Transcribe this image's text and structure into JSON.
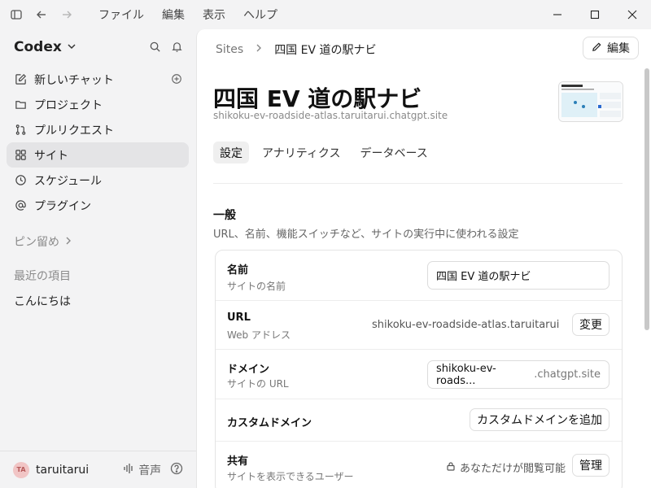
{
  "menubar": {
    "items": [
      "ファイル",
      "編集",
      "表示",
      "ヘルプ"
    ]
  },
  "sidebar": {
    "workspace": "Codex",
    "nav": [
      {
        "label": "新しいチャット",
        "icon": "edit-icon"
      },
      {
        "label": "プロジェクト",
        "icon": "folder-icon"
      },
      {
        "label": "プルリクエスト",
        "icon": "pull-request-icon"
      },
      {
        "label": "サイト",
        "icon": "grid-icon"
      },
      {
        "label": "スケジュール",
        "icon": "clock-icon"
      },
      {
        "label": "プラグイン",
        "icon": "at-icon"
      }
    ],
    "pinned_label": "ピン留め",
    "recent_label": "最近の項目",
    "recent_chats": [
      "こんにちは"
    ],
    "user": {
      "initials": "TA",
      "name": "taruitarui"
    },
    "voice_label": "音声"
  },
  "main": {
    "breadcrumb": {
      "root": "Sites",
      "current": "四国 EV 道の駅ナビ"
    },
    "edit_label": "編集",
    "title": "四国 EV 道の駅ナビ",
    "url": "shikoku-ev-roadside-atlas.taruitarui.chatgpt.site",
    "tabs": [
      "設定",
      "アナリティクス",
      "データベース"
    ],
    "active_tab": "設定",
    "section": {
      "title": "一般",
      "description": "URL、名前、機能スイッチなど、サイトの実行中に使われる設定"
    },
    "settings": {
      "name": {
        "label": "名前",
        "sub": "サイトの名前",
        "value": "四国 EV 道の駅ナビ"
      },
      "url": {
        "label": "URL",
        "sub": "Web アドレス",
        "value": "shikoku-ev-roadside-atlas.taruitarui.c...",
        "button": "変更"
      },
      "domain": {
        "label": "ドメイン",
        "sub": "サイトの URL",
        "value": "shikoku-ev-roads...",
        "suffix": ".chatgpt.site"
      },
      "custom_domain": {
        "label": "カスタムドメイン",
        "button": "カスタムドメインを追加"
      },
      "share": {
        "label": "共有",
        "sub": "サイトを表示できるユーザー",
        "status": "あなただけが閲覧可能",
        "button": "管理"
      }
    }
  }
}
